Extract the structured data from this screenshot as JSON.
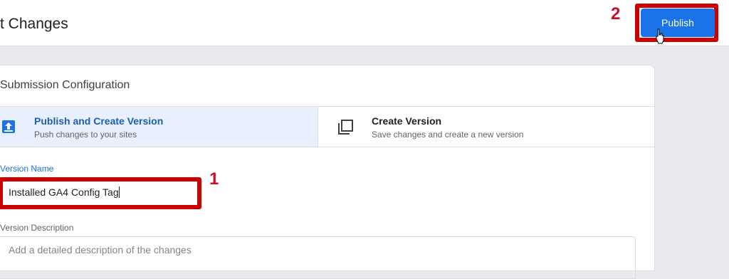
{
  "header": {
    "title": "t Changes",
    "publish_label": "Publish"
  },
  "annotations": {
    "step_publish": "2",
    "step_version_name": "1",
    "highlight_color": "#cc0000"
  },
  "submission": {
    "title": "Submission Configuration",
    "options": [
      {
        "title": "Publish and Create Version",
        "subtitle": "Push changes to your sites",
        "icon": "publish-upload-icon",
        "selected": true
      },
      {
        "title": "Create Version",
        "subtitle": "Save changes and create a new version",
        "icon": "copy-version-icon",
        "selected": false
      }
    ]
  },
  "form": {
    "version_name_label": "Version Name",
    "version_name_value": "Installed GA4 Config Tag",
    "version_description_label": "Version Description",
    "version_description_placeholder": "Add a detailed description of the changes"
  },
  "colors": {
    "accent": "#1a73e8",
    "selected_bg": "#e8f0fe"
  }
}
